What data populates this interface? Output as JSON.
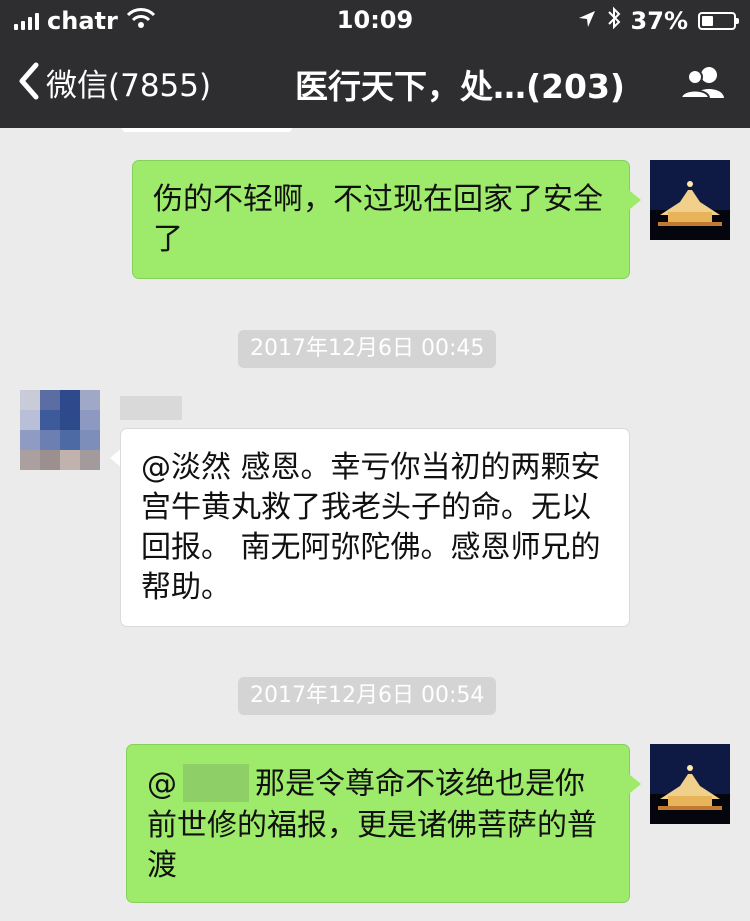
{
  "status_bar": {
    "carrier": "chatr",
    "time": "10:09",
    "battery": "37%",
    "battery_level": 0.37
  },
  "nav": {
    "back_label": "微信(7855)",
    "title": "医行天下，处…(203)"
  },
  "messages": [
    {
      "side": "right",
      "text": "伤的不轻啊，不过现在回家了安全了"
    },
    {
      "timestamp": "2017年12月6日 00:45"
    },
    {
      "side": "left",
      "text": "@淡然  感恩。幸亏你当初的两颗安宫牛黄丸救了我老头子的命。无以回报。 南无阿弥陀佛。感恩师兄的帮助。"
    },
    {
      "timestamp": "2017年12月6日 00:54"
    },
    {
      "side": "right",
      "prefix": "@",
      "text": "那是令尊命不该绝也是你前世修的福报，更是诸佛菩萨的普渡"
    }
  ]
}
